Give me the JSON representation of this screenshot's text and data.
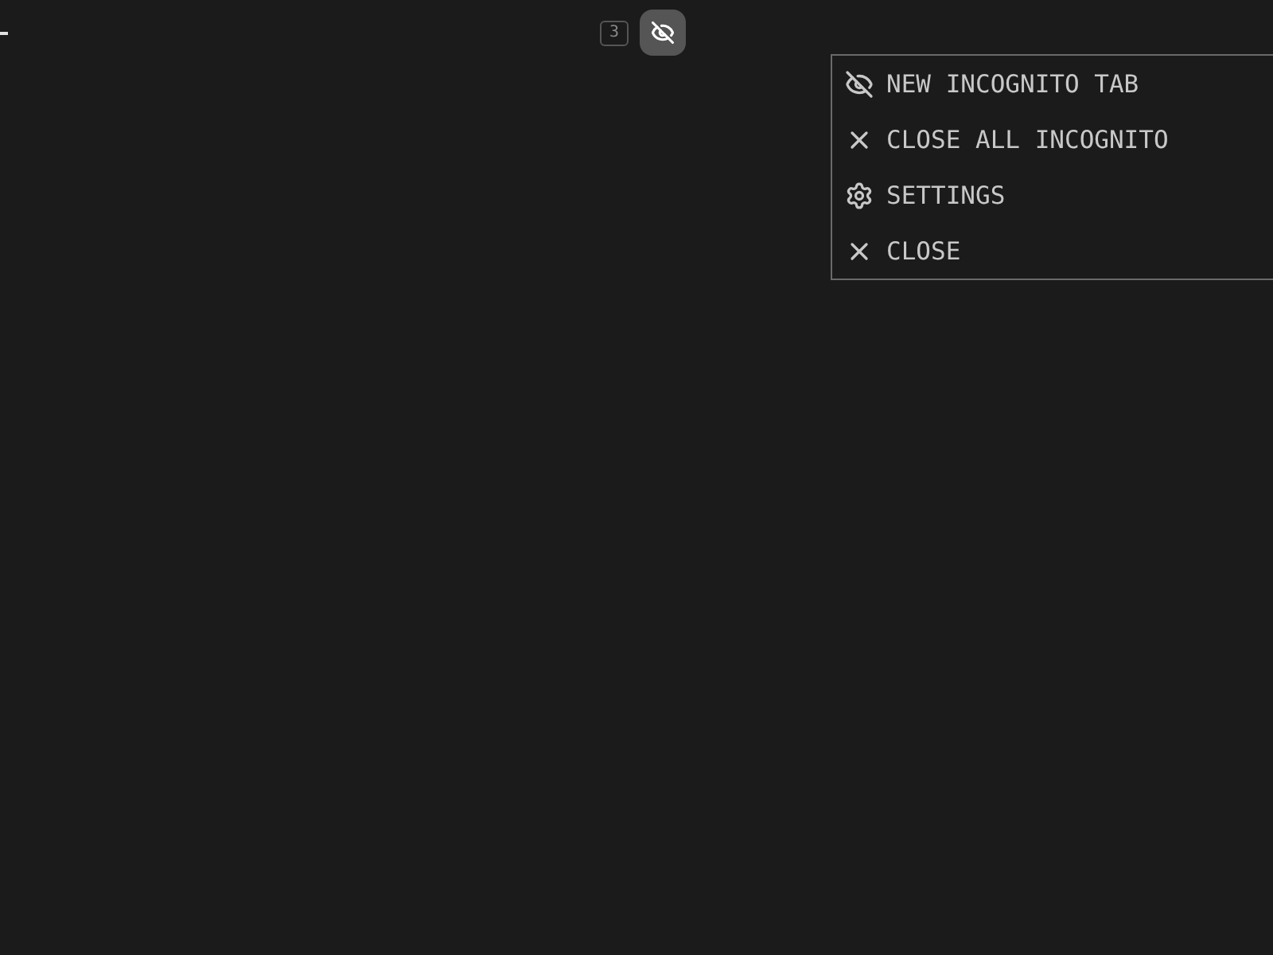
{
  "tab_counter": {
    "count": "3"
  },
  "menu": {
    "items": [
      {
        "kind": "incognito",
        "label": "NEW INCOGNITO TAB"
      },
      {
        "kind": "close",
        "label": "CLOSE ALL INCOGNITO"
      },
      {
        "kind": "settings",
        "label": "SETTINGS"
      },
      {
        "kind": "close",
        "label": "CLOSE"
      }
    ]
  }
}
